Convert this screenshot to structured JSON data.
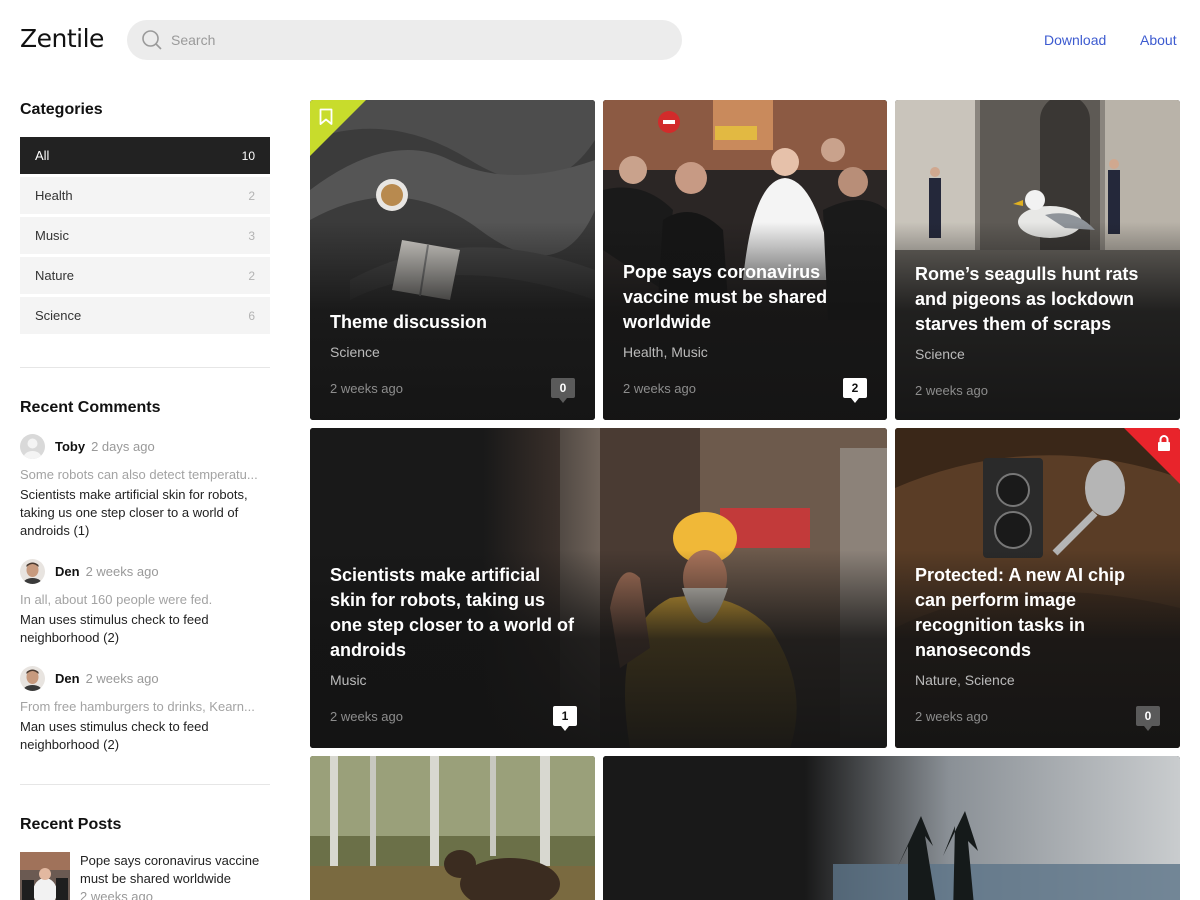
{
  "header": {
    "logo": "Zentile",
    "search_placeholder": "Search",
    "nav": [
      "Download",
      "About"
    ]
  },
  "sidebar": {
    "categories_title": "Categories",
    "categories": [
      {
        "label": "All",
        "count": "10",
        "active": true
      },
      {
        "label": "Health",
        "count": "2"
      },
      {
        "label": "Music",
        "count": "3"
      },
      {
        "label": "Nature",
        "count": "2"
      },
      {
        "label": "Science",
        "count": "6"
      }
    ],
    "comments_title": "Recent Comments",
    "comments": [
      {
        "author": "Toby",
        "date": "2 days ago",
        "excerpt": "Some robots can also detect temperatu...",
        "post": "Scientists make artificial skin for robots, taking us one step closer to a world of androids (1)"
      },
      {
        "author": "Den",
        "date": "2 weeks ago",
        "excerpt": "In all, about 160 people were fed.",
        "post": "Man uses stimulus check to feed neighborhood (2)"
      },
      {
        "author": "Den",
        "date": "2 weeks ago",
        "excerpt": "From free hamburgers to drinks, Kearn...",
        "post": "Man uses stimulus check to feed neighborhood (2)"
      }
    ],
    "posts_title": "Recent Posts",
    "recent_post": {
      "title": "Pope says coronavirus vaccine must be shared worldwide",
      "date": "2 weeks ago"
    }
  },
  "cards": [
    {
      "title": "Theme discussion",
      "categories": "Science",
      "date": "2 weeks ago",
      "comments": "0",
      "badge": "bookmark-icon"
    },
    {
      "title": "Pope says coronavirus vaccine must be shared worldwide",
      "categories": "Health, Music",
      "date": "2 weeks ago",
      "comments": "2"
    },
    {
      "title": "Rome’s seagulls hunt rats and pigeons as lockdown starves them of scraps",
      "categories": "Science",
      "date": "2 weeks ago"
    },
    {
      "title": "Scientists make artificial skin for robots, taking us one step closer to a world of androids",
      "categories": "Music",
      "date": "2 weeks ago",
      "comments": "1"
    },
    {
      "title": "Protected: A new AI chip can perform image recognition tasks in nanoseconds",
      "categories": "Nature, Science",
      "date": "2 weeks ago",
      "comments": "0",
      "badge": "lock-icon"
    }
  ],
  "colors": {
    "accent_link": "#3d5bd0",
    "featured_corner": "#c8dc2c",
    "protected_corner": "#e8242b",
    "active_category": "#222222"
  }
}
